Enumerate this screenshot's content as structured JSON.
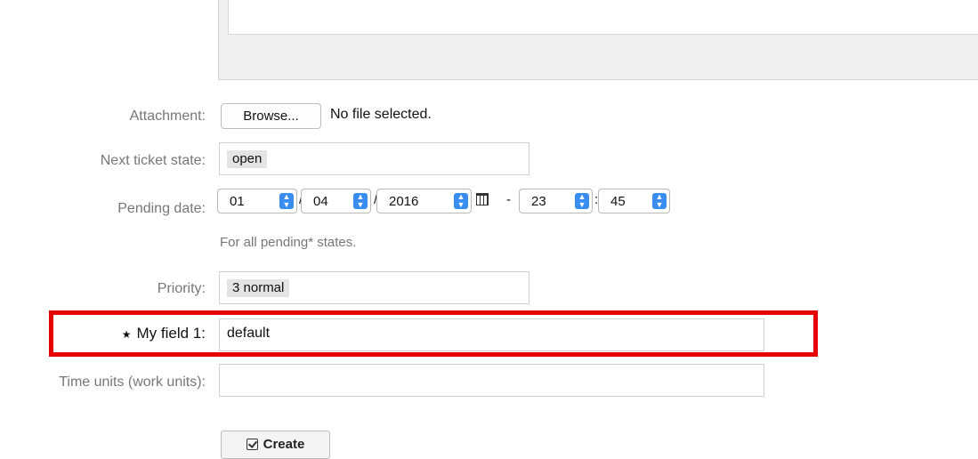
{
  "form": {
    "attachment": {
      "label": "Attachment:",
      "browse_button": "Browse...",
      "file_status": "No file selected."
    },
    "next_state": {
      "label": "Next ticket state:",
      "value": "open"
    },
    "pending_date": {
      "label": "Pending date:",
      "day": "01",
      "month": "04",
      "year": "2016",
      "hour": "23",
      "minute": "45",
      "date_separator": "/",
      "time_dash": "-",
      "time_separator": ":",
      "hint": "For all pending* states."
    },
    "priority": {
      "label": "Priority:",
      "value": "3 normal"
    },
    "my_field_1": {
      "required_marker": "★",
      "label": "My field 1:",
      "value": "default"
    },
    "time_units": {
      "label": "Time units (work units):",
      "value": ""
    },
    "create_button": "Create"
  },
  "icons": {
    "calendar": "calendar-icon",
    "create": "check-square-icon",
    "select_arrows": "updown-arrows-icon"
  },
  "colors": {
    "highlight": "#e60000",
    "select_spinner": "#3a8df0",
    "label": "#777777"
  }
}
